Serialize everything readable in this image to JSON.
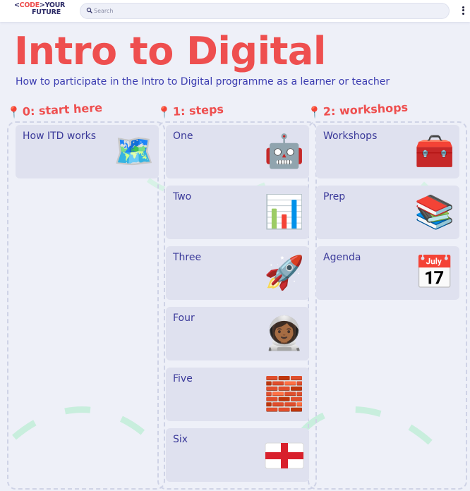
{
  "header": {
    "logo": {
      "bracket": "<",
      "code": "CODE",
      "arrow": ">",
      "your": "YOUR",
      "future": "FUTURE"
    },
    "search": {
      "placeholder": "Search",
      "icon": "search-icon"
    },
    "menu_icon": "more-vertical-icon"
  },
  "page": {
    "title": "Intro to Digital",
    "subtitle": "How to participate in the Intro to Digital programme as a learner or teacher"
  },
  "columns": [
    {
      "pin": "📍",
      "title": "0: start here",
      "cards": [
        {
          "label": "How ITD works",
          "emoji": "🗺️"
        }
      ]
    },
    {
      "pin": "📍",
      "title": "1: steps",
      "cards": [
        {
          "label": "One",
          "emoji": "🤖"
        },
        {
          "label": "Two",
          "emoji": "📊"
        },
        {
          "label": "Three",
          "emoji": "🚀"
        },
        {
          "label": "Four",
          "emoji": "👩🏾‍🚀"
        },
        {
          "label": "Five",
          "emoji": "🧱"
        },
        {
          "label": "Six",
          "emoji": "🏴󠁧󠁢󠁥󠁮󠁧󠁿"
        }
      ]
    },
    {
      "pin": "📍",
      "title": "2: workshops",
      "cards": [
        {
          "label": "Workshops",
          "emoji": "🧰"
        },
        {
          "label": "Prep",
          "emoji": "📚"
        },
        {
          "label": "Agenda",
          "emoji": "📅"
        }
      ]
    }
  ],
  "colors": {
    "accent_red": "#ee4f4f",
    "navy": "#2b2a66",
    "link_blue": "#3a3bb0",
    "card_bg": "#dfe1ef",
    "background": "#eef0f8",
    "decor_green": "#c8eedd"
  }
}
